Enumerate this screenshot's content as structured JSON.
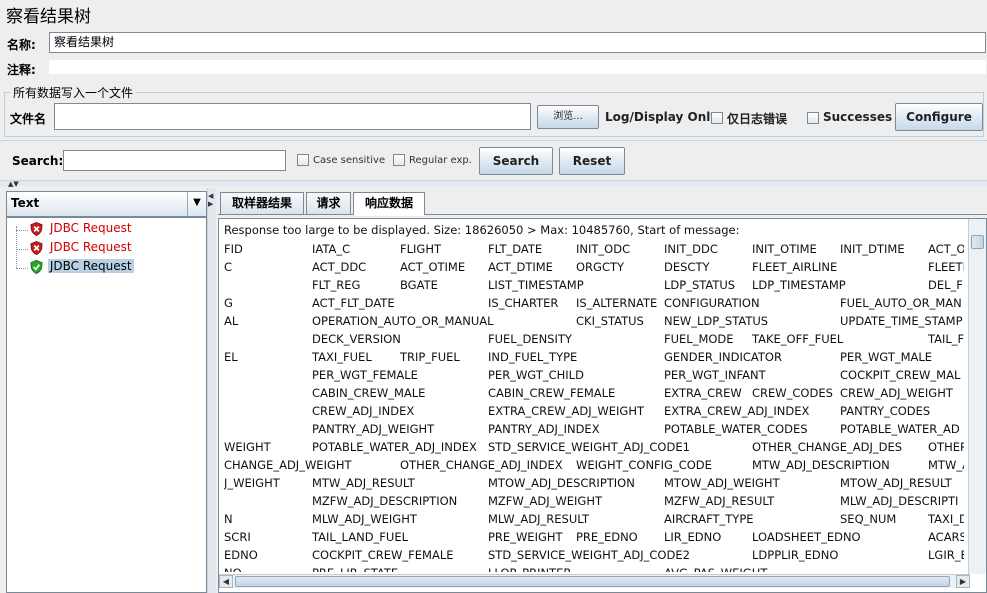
{
  "window": {
    "title": "察看结果树"
  },
  "form": {
    "name_label": "名称:",
    "name_value": "察看结果树",
    "comment_label": "注释:",
    "comment_value": ""
  },
  "file_group": {
    "title": "所有数据写入一个文件",
    "filename_label": "文件名",
    "filename_value": "",
    "browse_label": "浏览...",
    "log_display_label": "Log/Display Only:",
    "errors_only_label": "仅日志错误",
    "successes_label": "Successes",
    "configure_label": "Configure"
  },
  "search": {
    "label": "Search:",
    "value": "",
    "case_sensitive_label": "Case sensitive",
    "regex_label": "Regular exp.",
    "search_button": "Search",
    "reset_button": "Reset"
  },
  "renderer": {
    "selected": "Text"
  },
  "tree": [
    {
      "label": "JDBC Request",
      "status": "error"
    },
    {
      "label": "JDBC Request",
      "status": "error"
    },
    {
      "label": "JDBC Request",
      "status": "success"
    }
  ],
  "tabs": [
    "取样器结果",
    "请求",
    "响应数据"
  ],
  "response": {
    "header_line": "Response too large to be displayed. Size: 18626050 > Max: 10485760, Start of message:",
    "rows": [
      [
        [
          "FID",
          0
        ],
        [
          "IATA_C",
          88
        ],
        [
          "FLIGHT",
          176
        ],
        [
          "FLT_DATE",
          264
        ],
        [
          "INIT_ODC",
          352
        ],
        [
          "INIT_DDC",
          440
        ],
        [
          "INIT_OTIME",
          528
        ],
        [
          "INIT_DTIME",
          616
        ],
        [
          "ACT_O",
          704
        ]
      ],
      [
        [
          "C",
          0
        ],
        [
          "ACT_DDC",
          88
        ],
        [
          "ACT_OTIME",
          176
        ],
        [
          "ACT_DTIME",
          264
        ],
        [
          "ORGCTY",
          352
        ],
        [
          "DESCTY",
          440
        ],
        [
          "FLEET_AIRLINE",
          528
        ],
        [
          "FLEETI",
          704
        ]
      ],
      [
        [
          "FLT_REG",
          88
        ],
        [
          "BGATE",
          176
        ],
        [
          "LIST_TIMESTAMP",
          264
        ],
        [
          "LDP_STATUS",
          440
        ],
        [
          "LDP_TIMESTAMP",
          528
        ],
        [
          "DEL_F",
          704
        ]
      ],
      [
        [
          "G",
          0
        ],
        [
          "ACT_FLT_DATE",
          88
        ],
        [
          "IS_CHARTER",
          264
        ],
        [
          "IS_ALTERNATE",
          352
        ],
        [
          "CONFIGURATION",
          440
        ],
        [
          "FUEL_AUTO_OR_MAN",
          616
        ]
      ],
      [
        [
          "AL",
          0
        ],
        [
          "OPERATION_AUTO_OR_MANUAL",
          88
        ],
        [
          "CKI_STATUS",
          352
        ],
        [
          "NEW_LDP_STATUS",
          440
        ],
        [
          "UPDATE_TIME_STAMP",
          616
        ]
      ],
      [
        [
          "DECK_VERSION",
          88
        ],
        [
          "FUEL_DENSITY",
          264
        ],
        [
          "FUEL_MODE",
          440
        ],
        [
          "TAKE_OFF_FUEL",
          528
        ],
        [
          "TAIL_FU",
          704
        ]
      ],
      [
        [
          "EL",
          0
        ],
        [
          "TAXI_FUEL",
          88
        ],
        [
          "TRIP_FUEL",
          176
        ],
        [
          "IND_FUEL_TYPE",
          264
        ],
        [
          "GENDER_INDICATOR",
          440
        ],
        [
          "PER_WGT_MALE",
          616
        ]
      ],
      [
        [
          "PER_WGT_FEMALE",
          88
        ],
        [
          "PER_WGT_CHILD",
          264
        ],
        [
          "PER_WGT_INFANT",
          440
        ],
        [
          "COCKPIT_CREW_MAL",
          616
        ]
      ],
      [
        [
          "CABIN_CREW_MALE",
          88
        ],
        [
          "CABIN_CREW_FEMALE",
          264
        ],
        [
          "EXTRA_CREW",
          440
        ],
        [
          "CREW_CODES",
          528
        ],
        [
          "CREW_ADJ_WEIGHT",
          616
        ]
      ],
      [
        [
          "CREW_ADJ_INDEX",
          88
        ],
        [
          "EXTRA_CREW_ADJ_WEIGHT",
          264
        ],
        [
          "EXTRA_CREW_ADJ_INDEX",
          440
        ],
        [
          "PANTRY_CODES",
          616
        ]
      ],
      [
        [
          "PANTRY_ADJ_WEIGHT",
          88
        ],
        [
          "PANTRY_ADJ_INDEX",
          264
        ],
        [
          "POTABLE_WATER_CODES",
          440
        ],
        [
          "POTABLE_WATER_AD",
          616
        ]
      ],
      [
        [
          "WEIGHT",
          0
        ],
        [
          "POTABLE_WATER_ADJ_INDEX",
          88
        ],
        [
          "STD_SERVICE_WEIGHT_ADJ_CODE1",
          264
        ],
        [
          "OTHER_CHANGE_ADJ_DES",
          528
        ],
        [
          "OTHER",
          704
        ]
      ],
      [
        [
          "CHANGE_ADJ_WEIGHT",
          0
        ],
        [
          "OTHER_CHANGE_ADJ_INDEX",
          176
        ],
        [
          "WEIGHT_CONFIG_CODE",
          352
        ],
        [
          "MTW_ADJ_DESCRIPTION",
          528
        ],
        [
          "MTW_A",
          704
        ]
      ],
      [
        [
          "J_WEIGHT",
          0
        ],
        [
          "MTW_ADJ_RESULT",
          88
        ],
        [
          "MTOW_ADJ_DESCRIPTION",
          264
        ],
        [
          "MTOW_ADJ_WEIGHT",
          440
        ],
        [
          "MTOW_ADJ_RESULT",
          616
        ]
      ],
      [
        [
          "MZFW_ADJ_DESCRIPTION",
          88
        ],
        [
          "MZFW_ADJ_WEIGHT",
          264
        ],
        [
          "MZFW_ADJ_RESULT",
          440
        ],
        [
          "MLW_ADJ_DESCRIPTI",
          616
        ]
      ],
      [
        [
          "N",
          0
        ],
        [
          "MLW_ADJ_WEIGHT",
          88
        ],
        [
          "MLW_ADJ_RESULT",
          264
        ],
        [
          "AIRCRAFT_TYPE",
          440
        ],
        [
          "SEQ_NUM",
          616
        ],
        [
          "TAXI_D",
          704
        ]
      ],
      [
        [
          "SCRI",
          0
        ],
        [
          "TAIL_LAND_FUEL",
          88
        ],
        [
          "PRE_WEIGHT",
          264
        ],
        [
          "PRE_EDNO",
          352
        ],
        [
          "LIR_EDNO",
          440
        ],
        [
          "LOADSHEET_EDNO",
          528
        ],
        [
          "ACARS",
          704
        ]
      ],
      [
        [
          "EDNO",
          0
        ],
        [
          "COCKPIT_CREW_FEMALE",
          88
        ],
        [
          "STD_SERVICE_WEIGHT_ADJ_CODE2",
          264
        ],
        [
          "LDPPLIR_EDNO",
          528
        ],
        [
          "LGIR_E",
          704
        ]
      ],
      [
        [
          "NO",
          0
        ],
        [
          "PRE_LIR_STATE",
          88
        ],
        [
          "LLOP_PRINTER",
          264
        ],
        [
          "AVG_PAS_WEIGHT",
          440
        ]
      ]
    ]
  },
  "colors": {
    "error_text": "#d40000",
    "selected_bg": "#b8cfe5",
    "border": "#7a8a99"
  }
}
